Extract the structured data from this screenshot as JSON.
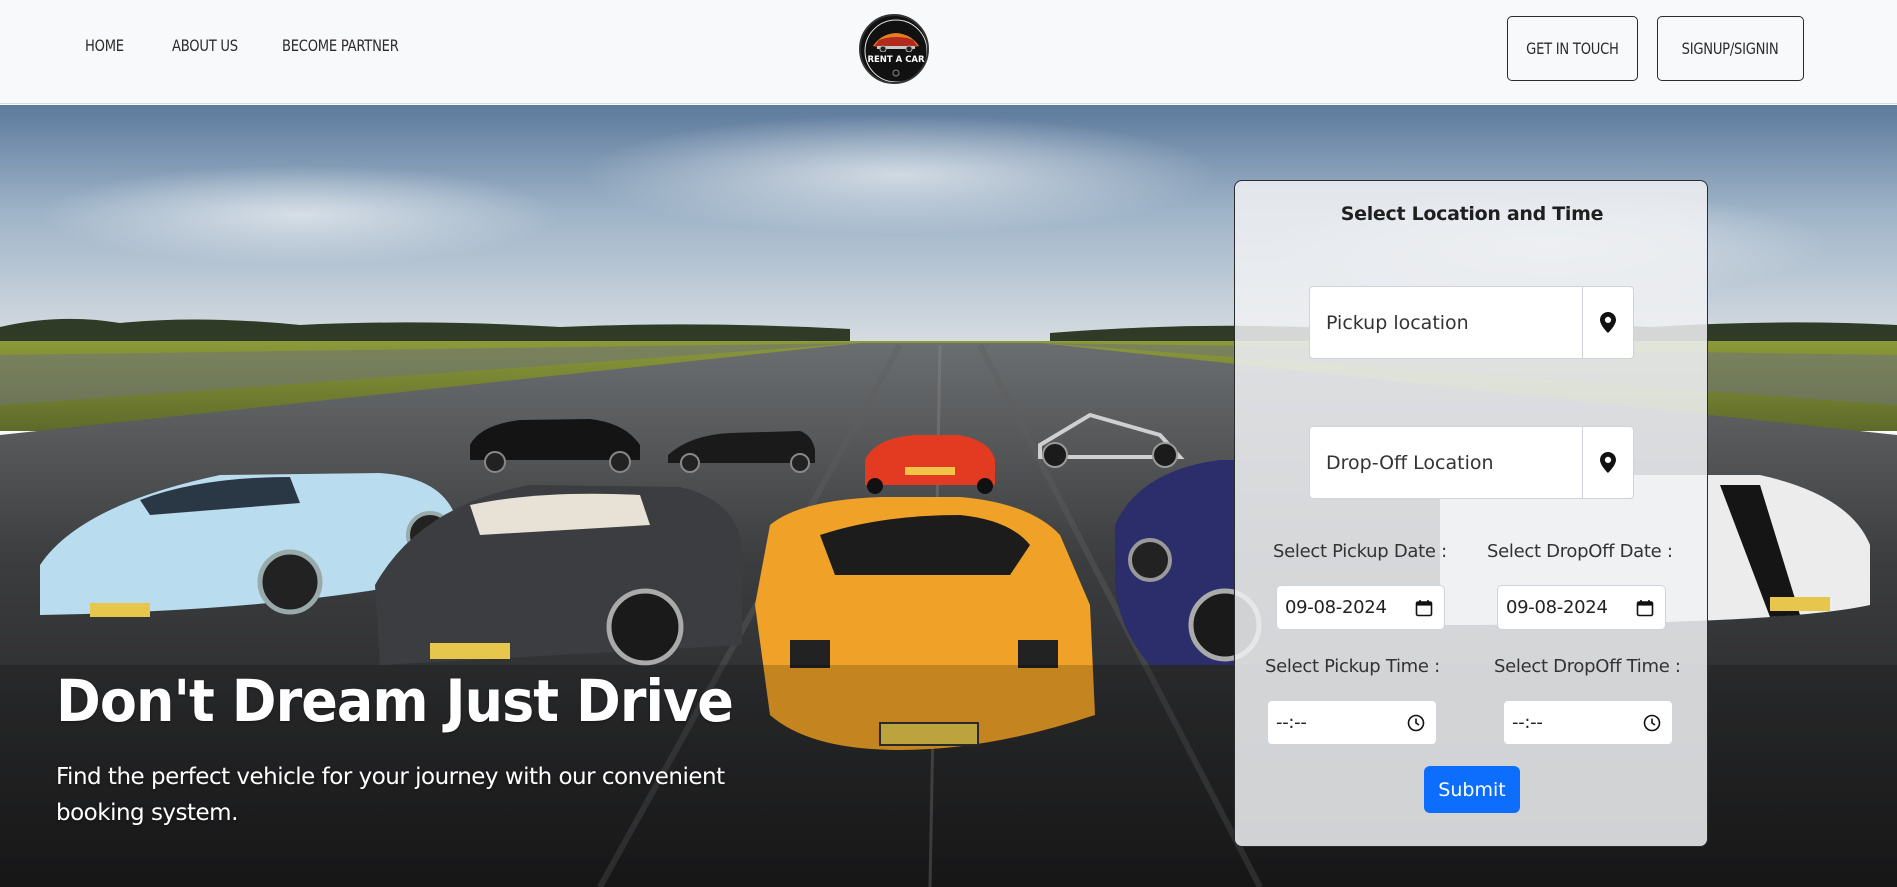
{
  "nav": {
    "home": "HOME",
    "about": "ABOUT US",
    "partner": "BECOME PARTNER",
    "get_in_touch": "GET IN TOUCH",
    "signup": "SIGNUP/SIGNIN"
  },
  "logo": {
    "text": "RENT A CAR",
    "icon": "car-logo-icon"
  },
  "hero": {
    "title": "Don't Dream Just Drive",
    "subtitle": "Find the perfect vehicle for your journey with our convenient booking system."
  },
  "form": {
    "title": "Select Location and Time",
    "pickup_location_placeholder": "Pickup location",
    "dropoff_location_placeholder": "Drop-Off Location",
    "location_icon": "map-pin-icon",
    "pickup_date_label": "Select Pickup Date :",
    "dropoff_date_label": "Select DropOff Date :",
    "pickup_date_value": "09-08-2024",
    "dropoff_date_value": "09-08-2024",
    "calendar_icon": "calendar-icon",
    "pickup_time_label": "Select Pickup Time :",
    "dropoff_time_label": "Select DropOff Time :",
    "pickup_time_value": "--:--",
    "dropoff_time_value": "--:--",
    "clock_icon": "clock-icon",
    "submit_label": "Submit"
  },
  "colors": {
    "primary": "#0d6efd",
    "navbar_bg": "#f8f9fa",
    "text_dark": "#2b2b2b"
  }
}
